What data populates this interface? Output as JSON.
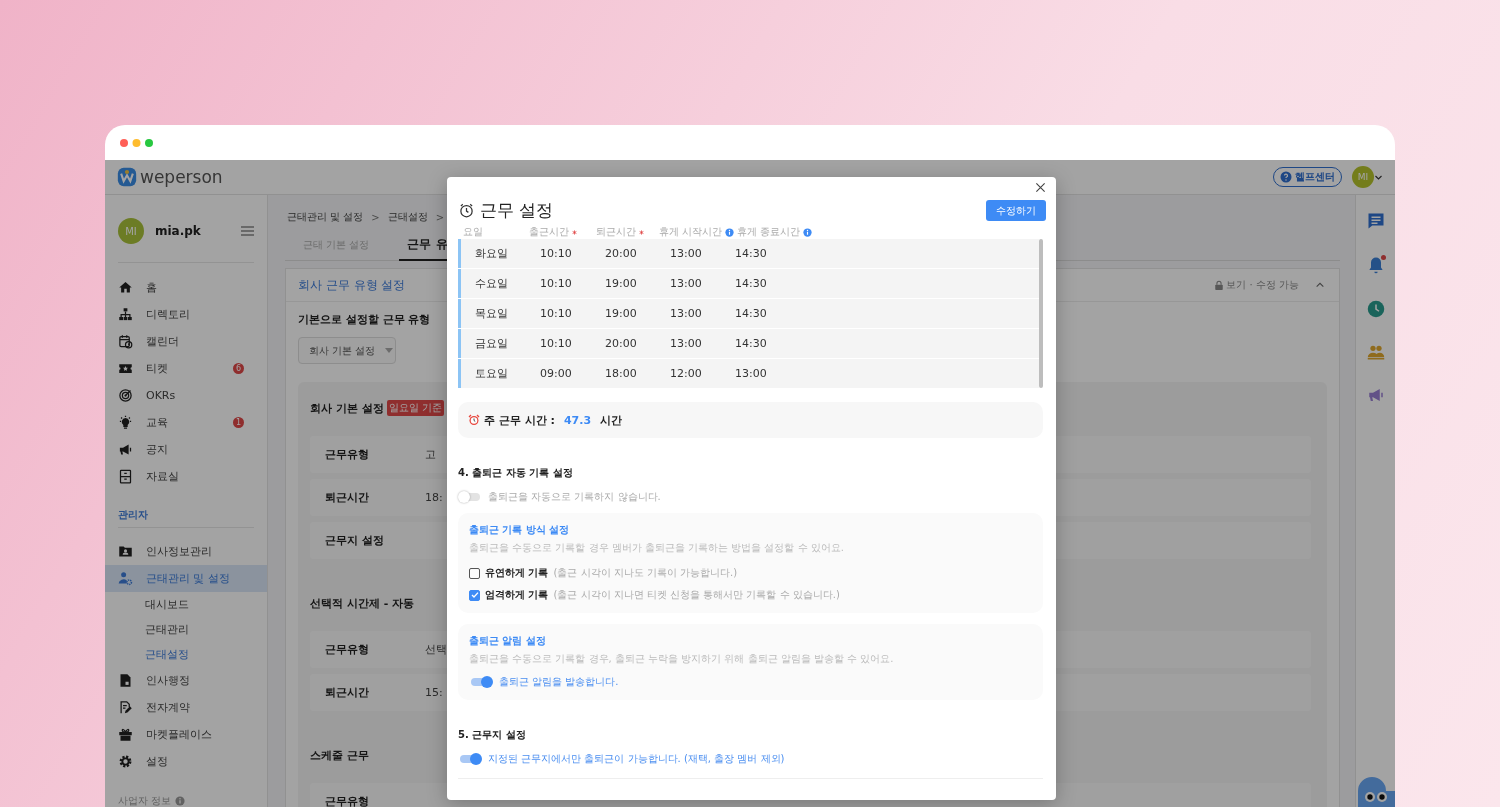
{
  "header": {
    "logo": "weperson",
    "help_button": "헬프센터",
    "avatar": "MI"
  },
  "sidebar": {
    "user": {
      "avatar": "MI",
      "name": "mia.pk"
    },
    "items": [
      {
        "label": "홈",
        "selected": false
      },
      {
        "label": "디렉토리",
        "selected": false
      },
      {
        "label": "캘린더",
        "selected": false
      },
      {
        "label": "티켓",
        "badge": "6",
        "selected": false
      },
      {
        "label": "OKRs",
        "selected": false
      },
      {
        "label": "교육",
        "badge": "1",
        "selected": false
      },
      {
        "label": "공지",
        "selected": false
      },
      {
        "label": "자료실",
        "selected": false
      }
    ],
    "admin": {
      "heading": "관리자",
      "items": [
        {
          "label": "인사정보관리",
          "selected": false
        },
        {
          "label": "근태관리 및 설정",
          "selected": true,
          "children": [
            {
              "label": "대시보드",
              "selected": false
            },
            {
              "label": "근태관리",
              "selected": false
            },
            {
              "label": "근태설정",
              "selected": true
            }
          ]
        },
        {
          "label": "인사행정",
          "selected": false
        },
        {
          "label": "전자계약",
          "selected": false
        },
        {
          "label": "마켓플레이스",
          "selected": false
        },
        {
          "label": "설정",
          "selected": false
        }
      ]
    },
    "footer": "사업자 정보"
  },
  "main": {
    "breadcrumb": [
      {
        "kind": "link",
        "text": "근태관리 및 설정"
      },
      {
        "kind": "separator",
        "text": ">"
      },
      {
        "kind": "link",
        "text": "근태설정"
      },
      {
        "kind": "separator",
        "text": ">"
      }
    ],
    "tabs": [
      {
        "label": "근태 기본 설정",
        "selected": false
      },
      {
        "label": "근무 유",
        "selected": true
      }
    ],
    "panel": {
      "title": "회사 근무 유형 설정",
      "access": "보기 · 수정 가능",
      "default_type": {
        "label": "기본으로 설정할 근무 유형",
        "value": "회사 기본 설정"
      },
      "work_types": [
        {
          "name": "회사 기본 설정",
          "tag": "일요일 기준",
          "rows": [
            {
              "label": "근무유형",
              "value": "고"
            },
            {
              "label": "퇴근시간",
              "value": "18:"
            },
            {
              "label": "근무지 설정"
            }
          ]
        },
        {
          "name": "선택적 시간제 - 자동",
          "rows": [
            {
              "label": "근무유형",
              "value": "선택"
            },
            {
              "label": "퇴근시간",
              "value": "15:"
            }
          ]
        },
        {
          "name": "스케줄 근무",
          "rows": [
            {
              "label": "근무유형"
            }
          ]
        }
      ]
    }
  },
  "rail": {
    "unread_notifications": true
  },
  "modal": {
    "title": "근무 설정",
    "edit_button": "수정하기",
    "columns": [
      {
        "label": "요일",
        "required": false,
        "info": false
      },
      {
        "label": "출근시간",
        "required": true,
        "info": false
      },
      {
        "label": "퇴근시간",
        "required": true,
        "info": false
      },
      {
        "label": "휴게 시작시간",
        "required": false,
        "info": true
      },
      {
        "label": "휴게 종료시간",
        "required": false,
        "info": true
      }
    ],
    "rows": [
      [
        "화요일",
        "10:10",
        "20:00",
        "13:00",
        "14:30"
      ],
      [
        "수요일",
        "10:10",
        "19:00",
        "13:00",
        "14:30"
      ],
      [
        "목요일",
        "10:10",
        "19:00",
        "13:00",
        "14:30"
      ],
      [
        "금요일",
        "10:10",
        "20:00",
        "13:00",
        "14:30"
      ],
      [
        "토요일",
        "09:00",
        "18:00",
        "12:00",
        "13:00"
      ]
    ],
    "weekly_total": {
      "label": "주 근무 시간 :",
      "value": "47.3",
      "unit": "시간"
    },
    "sections": [
      {
        "title": "4. 출퇴근 자동 기록 설정",
        "toggle": {
          "on": false,
          "label": "출퇴근을 자동으로 기록하지 않습니다."
        },
        "cards": [
          {
            "kind": "checkboxes",
            "title": "출퇴근 기록 방식 설정",
            "description": "출퇴근을 수동으로 기록할 경우 멤버가 출퇴근을 기록하는 방법을 설정할 수 있어요.",
            "options": [
              {
                "label": "유연하게 기록",
                "note": "(출근 시각이 지나도 기록이 가능합니다.)",
                "checked": false
              },
              {
                "label": "엄격하게 기록",
                "note": "(출근 시각이 지나면 티켓 신청을 통해서만 기록할 수 있습니다.)",
                "checked": true
              }
            ]
          },
          {
            "kind": "toggle",
            "title": "출퇴근 알림 설정",
            "description": "출퇴근을 수동으로 기록할 경우, 출퇴근 누락을 방지하기 위해 출퇴근 알림을 발송할 수 있어요.",
            "toggle": {
              "on": true,
              "label": "출퇴근 알림을 발송합니다."
            }
          }
        ]
      },
      {
        "title": "5. 근무지 설정",
        "toggle": {
          "on": true,
          "label": "지정된 근무지에서만 출퇴근이 가능합니다. (재택, 출장 멤버 제외)"
        }
      }
    ]
  }
}
